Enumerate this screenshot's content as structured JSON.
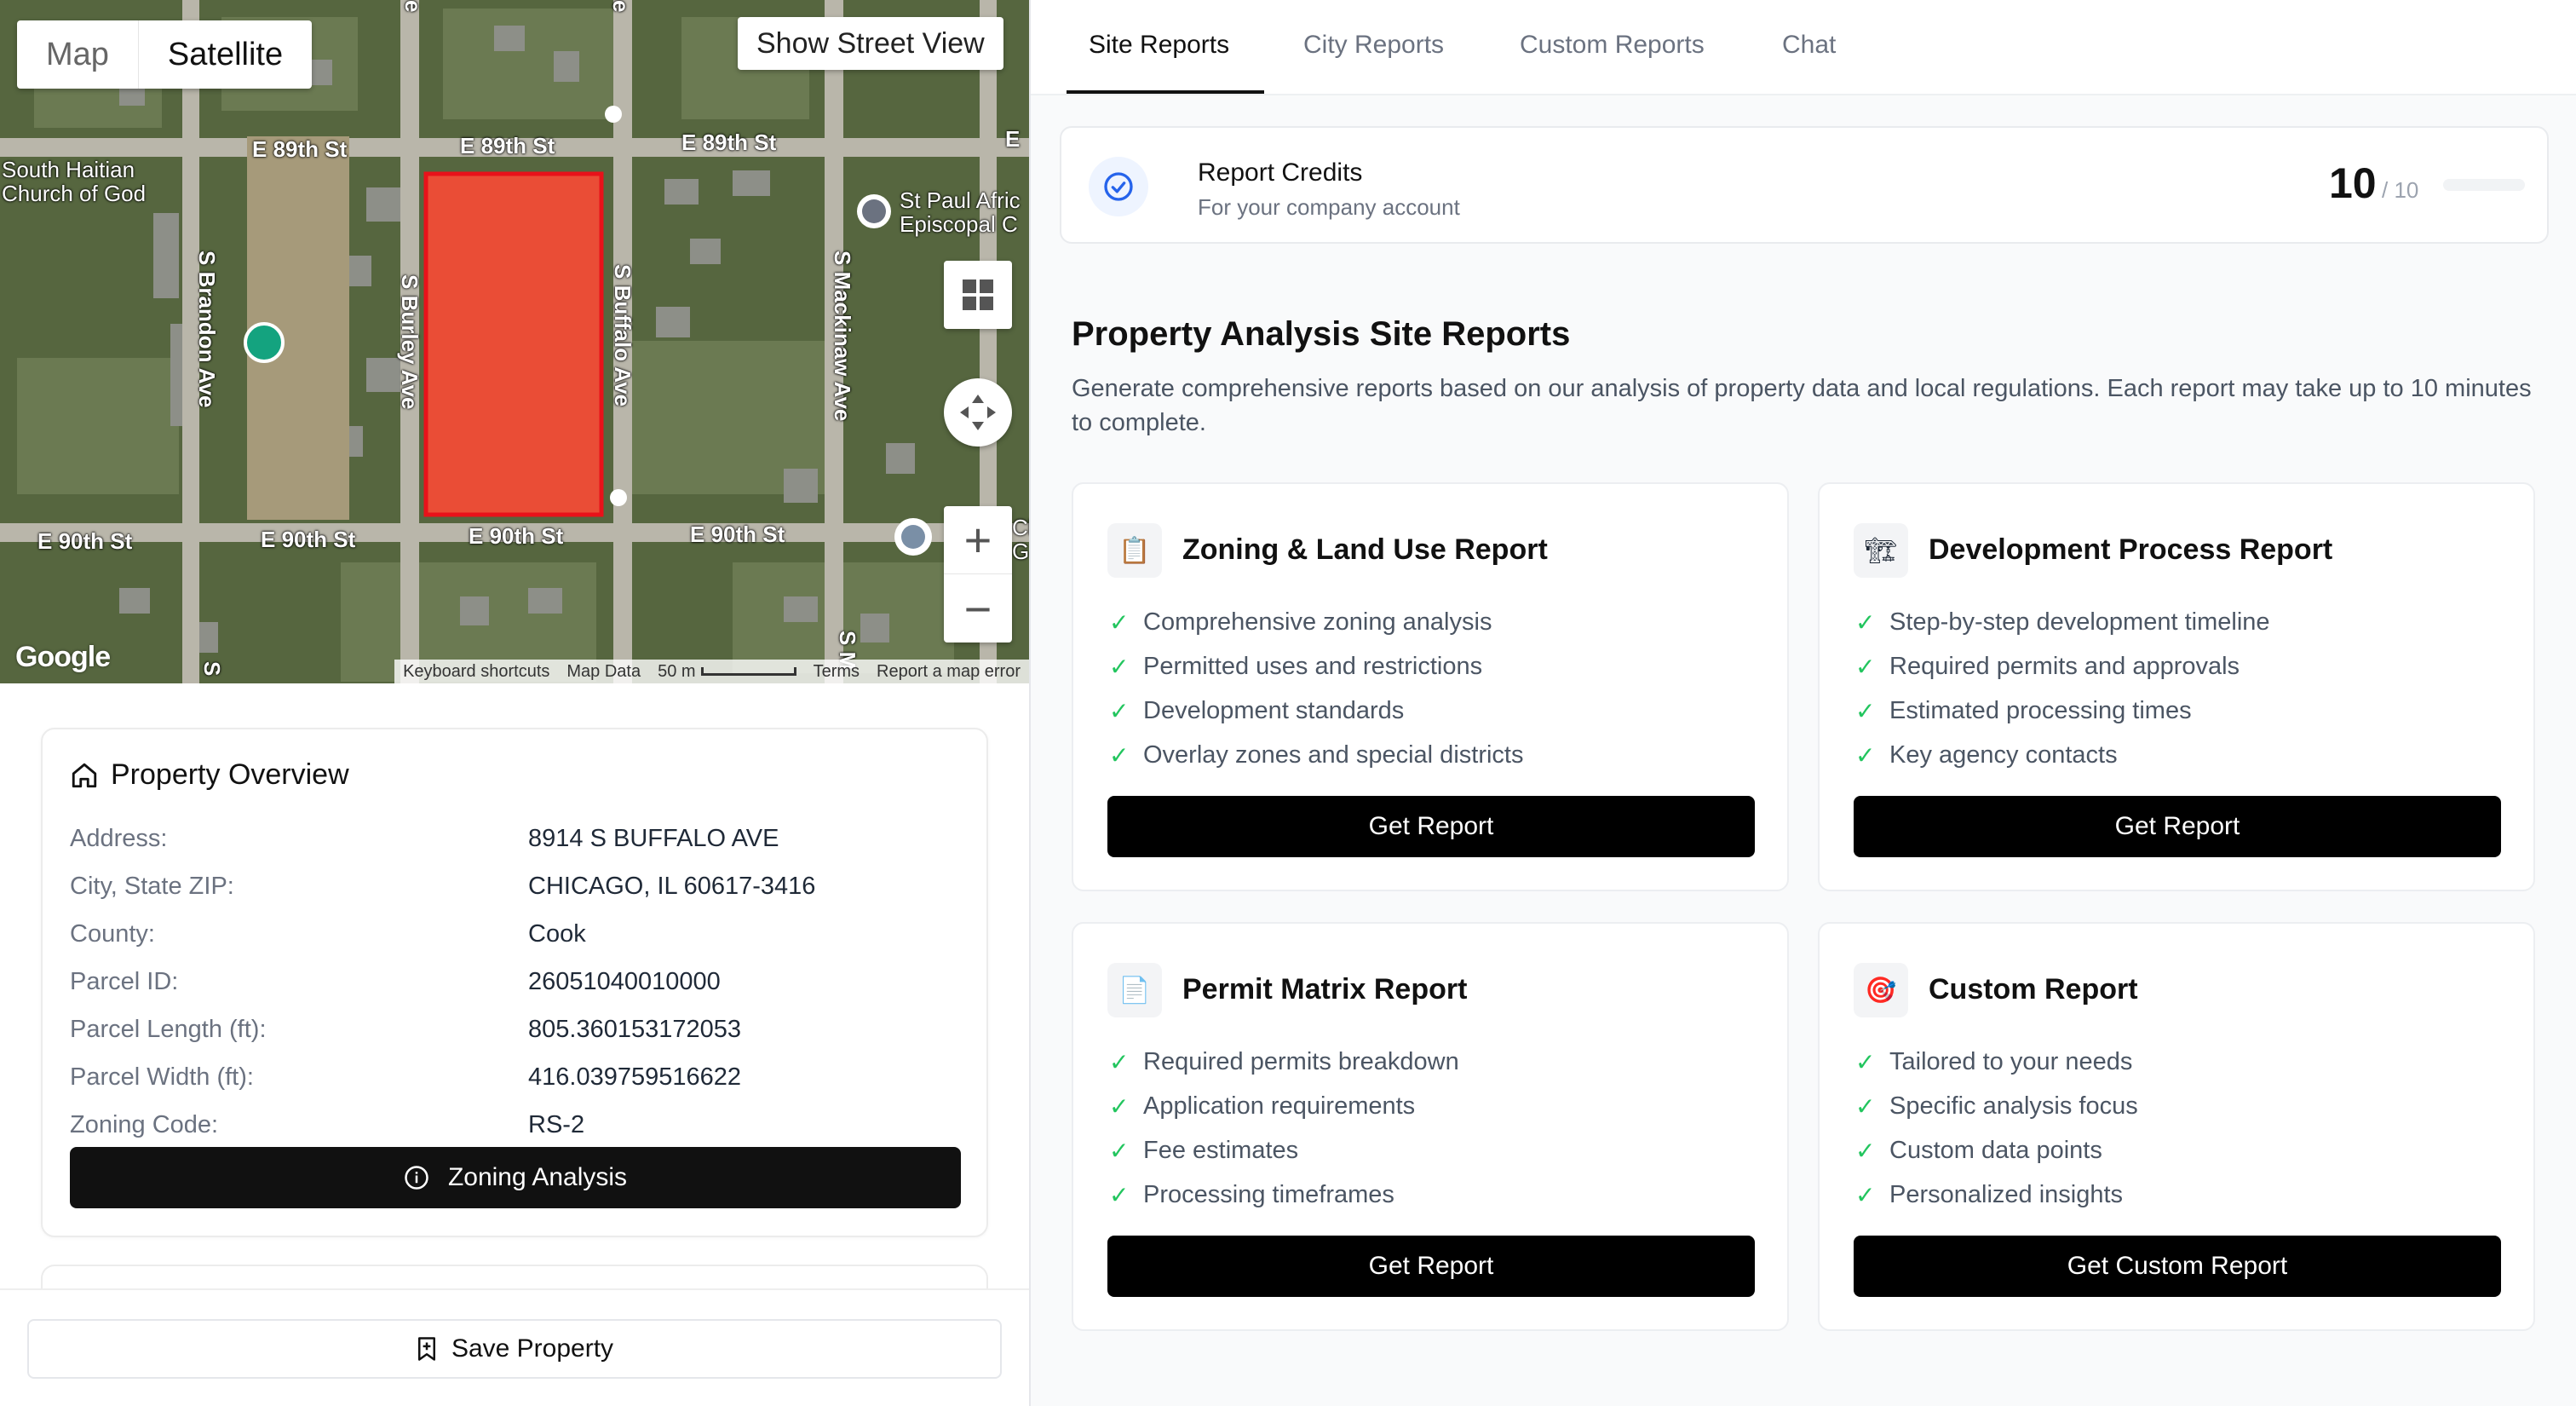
{
  "map": {
    "type_map": "Map",
    "type_satellite": "Satellite",
    "street_view": "Show Street View",
    "zoom_in": "+",
    "zoom_out": "−",
    "google": "Google",
    "attribution": {
      "shortcuts": "Keyboard shortcuts",
      "map_data": "Map Data",
      "scale": "50 m",
      "terms": "Terms",
      "report": "Report a map error"
    },
    "labels": {
      "e89_1": "E 89th St",
      "e89_2": "E 89th St",
      "e89_3": "E 89th St",
      "e89_cut": "E",
      "e90_1": "E 90th St",
      "e90_2": "E 90th St",
      "e90_3": "E 90th St",
      "e90_4": "E 90th St",
      "brandon": "S Brandon Ave",
      "burley": "S Burley Ave",
      "buffalo": "S Buffalo Ave",
      "mackinaw": "S Mackinaw Ave",
      "church1": "South Haitian",
      "church2": "Church of God",
      "stpaul1": "St Paul Afric",
      "stpaul2": "Episcopal C",
      "cut_ci": "Cl",
      "cut_g": "G",
      "top_e1": "e",
      "top_e2": "e",
      "bottom_s1": "S",
      "bottom_s2": "S M"
    }
  },
  "property": {
    "title": "Property Overview",
    "rows": [
      {
        "label": "Address:",
        "value": "8914 S BUFFALO AVE"
      },
      {
        "label": "City, State ZIP:",
        "value": "CHICAGO, IL 60617-3416"
      },
      {
        "label": "County:",
        "value": "Cook"
      },
      {
        "label": "Parcel ID:",
        "value": "26051040010000"
      },
      {
        "label": "Parcel Length (ft):",
        "value": "805.360153172053"
      },
      {
        "label": "Parcel Width (ft):",
        "value": "416.039759516622"
      },
      {
        "label": "Zoning Code:",
        "value": "RS-2"
      }
    ],
    "zoning_button": "Zoning Analysis",
    "save_button": "Save Property"
  },
  "tabs": [
    "Site Reports",
    "City Reports",
    "Custom Reports",
    "Chat"
  ],
  "active_tab": "Site Reports",
  "credits": {
    "title": "Report Credits",
    "subtitle": "For your company account",
    "count": "10",
    "total": "/ 10"
  },
  "section": {
    "title": "Property Analysis Site Reports",
    "description": "Generate comprehensive reports based on our analysis of property data and local regulations. Each report may take up to 10 minutes to complete."
  },
  "reports": [
    {
      "title": "Zoning & Land Use Report",
      "icon": "clipboard-icon",
      "items": [
        "Comprehensive zoning analysis",
        "Permitted uses and restrictions",
        "Development standards",
        "Overlay zones and special districts"
      ],
      "button": "Get Report"
    },
    {
      "title": "Development Process Report",
      "icon": "crane-icon",
      "items": [
        "Step-by-step development timeline",
        "Required permits and approvals",
        "Estimated processing times",
        "Key agency contacts"
      ],
      "button": "Get Report"
    },
    {
      "title": "Permit Matrix Report",
      "icon": "document-icon",
      "items": [
        "Required permits breakdown",
        "Application requirements",
        "Fee estimates",
        "Processing timeframes"
      ],
      "button": "Get Report"
    },
    {
      "title": "Custom Report",
      "icon": "target-icon",
      "items": [
        "Tailored to your needs",
        "Specific analysis focus",
        "Custom data points",
        "Personalized insights"
      ],
      "button": "Get Custom Report"
    }
  ],
  "colors": {
    "parcel_fill": "#ff4a35",
    "parcel_border": "#e8121a",
    "check": "#22c55e",
    "button": "#000000"
  }
}
